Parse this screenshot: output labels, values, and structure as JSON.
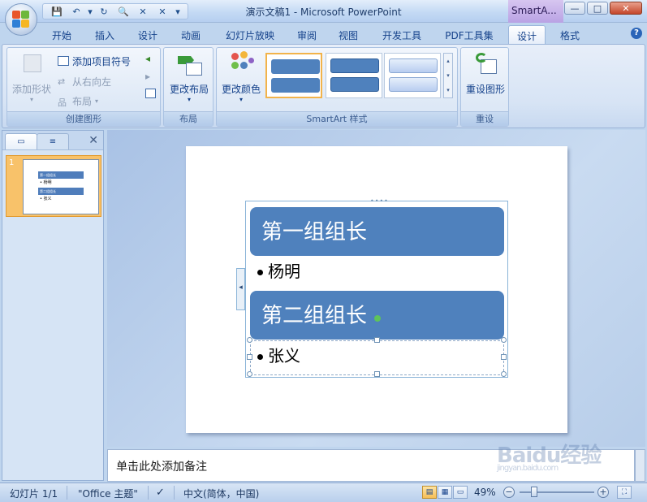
{
  "window": {
    "title": "演示文稿1 - Microsoft PowerPoint",
    "contextual_label": "SmartA...",
    "buttons": {
      "minimize": "—",
      "maximize": "□",
      "close": "✕"
    }
  },
  "quick_access": [
    "💾",
    "↶",
    "▾",
    "↻",
    "🔍",
    "✕",
    "✕",
    "▾"
  ],
  "tabs": [
    {
      "label": "开始"
    },
    {
      "label": "插入"
    },
    {
      "label": "设计"
    },
    {
      "label": "动画"
    },
    {
      "label": "幻灯片放映"
    },
    {
      "label": "审阅"
    },
    {
      "label": "视图"
    },
    {
      "label": "开发工具"
    },
    {
      "label": "PDF工具集"
    },
    {
      "label": "设计",
      "active": true
    },
    {
      "label": "格式"
    }
  ],
  "ribbon": {
    "create_graphic": {
      "label": "创建图形",
      "add_shape": "添加形状",
      "add_bullet": "添加项目符号",
      "right_to_left": "从右向左",
      "layout": "布局"
    },
    "layouts": {
      "label": "布局",
      "change_layout": "更改布局"
    },
    "styles": {
      "label": "SmartArt 样式",
      "change_colors": "更改颜色"
    },
    "reset": {
      "label": "重设",
      "reset_graphic": "重设图形"
    }
  },
  "slides_pane": {
    "slide_number": "1",
    "thumb_lines": [
      "第一组组长",
      "• 杨明",
      "第二组组长",
      "• 张义"
    ]
  },
  "slide": {
    "heading1": "第一组组长",
    "bullet1": "杨明",
    "heading2": "第二组组长",
    "bullet2": "张义"
  },
  "notes": {
    "placeholder": "单击此处添加备注"
  },
  "status": {
    "slide_info": "幻灯片 1/1",
    "theme": "\"Office 主题\"",
    "language": "中文(简体，中国)",
    "zoom": "49%"
  },
  "watermark": {
    "text": "Baidu经验",
    "sub": "jingyan.baidu.com"
  },
  "colors": {
    "accent": "#4f81bd",
    "ribbon": "#d7e4f5",
    "selected_thumb": "#f8c26a"
  }
}
